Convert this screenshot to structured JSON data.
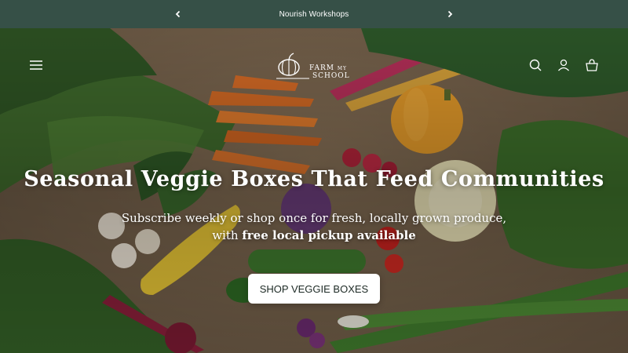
{
  "announcement": {
    "message": "Nourish Workshops",
    "prev_icon": "chevron-left-icon",
    "next_icon": "chevron-right-icon"
  },
  "header": {
    "logo": {
      "line1": "FARM",
      "small": "MY",
      "line2": "SCHOOL"
    },
    "icons": [
      "menu-icon",
      "search-icon",
      "account-icon",
      "cart-icon"
    ]
  },
  "hero": {
    "title": "Seasonal Veggie Boxes That Feed Communities",
    "subtitle_line1": "Subscribe weekly or shop once for fresh, locally grown produce,",
    "subtitle_line2_prefix": "with ",
    "subtitle_line2_bold": "free local pickup available",
    "cta_label": "SHOP VEGGIE BOXES"
  },
  "colors": {
    "announcement_bg": "#365047",
    "cta_bg": "#ffffff",
    "cta_text": "#1d2a25"
  }
}
